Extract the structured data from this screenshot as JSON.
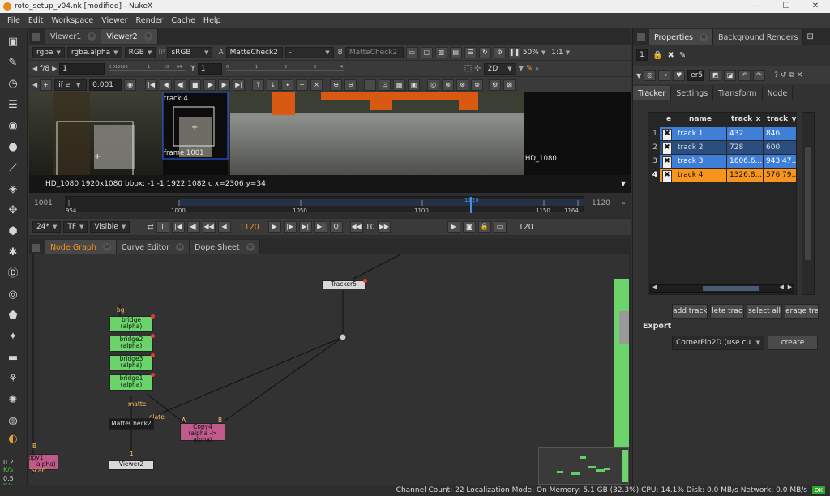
{
  "window": {
    "title": "roto_setup_v04.nk [modified] - NukeX",
    "minimize": "—",
    "maximize": "☐",
    "close": "✕"
  },
  "menu": [
    "File",
    "Edit",
    "Workspace",
    "Viewer",
    "Render",
    "Cache",
    "Help"
  ],
  "lefttoolbar": {
    "stats": [
      {
        "value": "0.2",
        "unit": "K/s"
      },
      {
        "value": "0.5",
        "unit": "K/s"
      }
    ]
  },
  "viewer": {
    "tabs": [
      "Viewer1",
      "Viewer2"
    ],
    "bar1": {
      "layer": "rgba",
      "channel": "rgba.alpha",
      "rgb": "RGB",
      "ip": "IP",
      "lut": "sRGB",
      "a_label": "A",
      "a_input": "MatteCheck2",
      "dash": "-",
      "b_label": "B",
      "b_input": "MatteCheck2",
      "zoom": "50%",
      "ratio": "1:1"
    },
    "bar2": {
      "fstop": "f/8",
      "frame_label": "1",
      "y_label": "Y",
      "y_value": "1",
      "mode": "2D",
      "ruler_ticks": [
        "0.015625",
        "1",
        "10",
        "64",
        "0",
        "1",
        "2",
        "3",
        "4"
      ]
    },
    "bar3": {
      "clip": "if er",
      "value": "0.001"
    },
    "overlay": {
      "track_label": "track 4",
      "frame_label": "frame 1001",
      "format_label": "HD_1080"
    },
    "status": "HD_1080 1920x1080  bbox: -1 -1 1922 1082 c  x=2306 y=34",
    "timeline": {
      "start": "1001",
      "end": "1120",
      "ticks": [
        "954",
        "1000",
        "1050",
        "1100",
        "1150",
        "1164"
      ],
      "current": "1120"
    },
    "playbar": {
      "fps": "24*",
      "tf": "TF",
      "visible": "Visible",
      "current_frame": "1120",
      "step": "10",
      "end_frame": "120"
    }
  },
  "nodegraph": {
    "tabs": [
      "Node Graph",
      "Curve Editor",
      "Dope Sheet"
    ],
    "nodes": {
      "tracker": "Tracker5",
      "bridge": "bridge",
      "bridge2": "bridge2",
      "bridge3": "bridge3",
      "bridge1": "bridge1",
      "alpha": "(alpha)",
      "mattecheck": "MatteCheck2",
      "copy4": "Copy4",
      "copy4_sub": "(alpha -> alpha)",
      "viewer": "Viewer2",
      "copy1": "opy1",
      "copy1_sub": "alpha)",
      "scan": "Scan",
      "bg": "bg",
      "matte": "matte",
      "isolate": "olate",
      "a": "A",
      "b": "B",
      "viewer_in": "1",
      "side_b": "B"
    }
  },
  "properties": {
    "tabs": [
      "Properties",
      "Background Renders"
    ],
    "count": "1",
    "node_name": "er5",
    "subtabs": [
      "Tracker",
      "Settings",
      "Transform",
      "Node"
    ],
    "columns": [
      "e",
      "name",
      "track_x",
      "track_y"
    ],
    "tracks": [
      {
        "idx": "1",
        "name": "track 1",
        "x": "432",
        "y": "846"
      },
      {
        "idx": "2",
        "name": "track 2",
        "x": "728",
        "y": "600"
      },
      {
        "idx": "3",
        "name": "track 3",
        "x": "1606.6...",
        "y": "943.47..."
      },
      {
        "idx": "4",
        "name": "track 4",
        "x": "1326.8...",
        "y": "576.79..."
      }
    ],
    "buttons": [
      "add track",
      "lete trac",
      "select all",
      "erage tra"
    ],
    "export_label": "Export",
    "export_option": "CornerPin2D (use cu",
    "create": "create"
  },
  "statusbar": "Channel Count: 22  Localization Mode: On  Memory: 5.1 GB (32.3%)  CPU: 14.1%  Disk: 0.0 MB/s  Network: 0.0 MB/s",
  "ok": "OK"
}
